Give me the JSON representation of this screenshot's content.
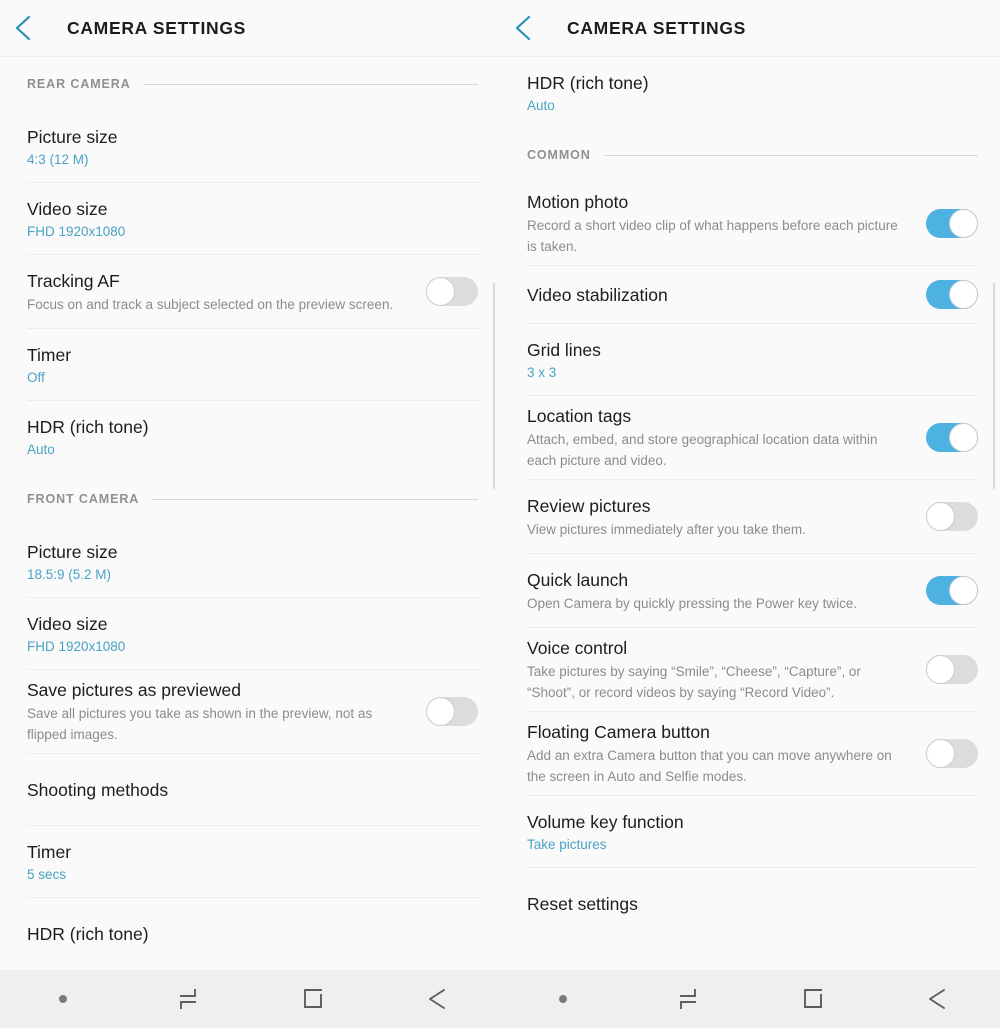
{
  "theme": {
    "accent_blue": "#4aa2c4",
    "toggle_on": "#4db2e2",
    "toggle_off": "#dcdcdc",
    "chevron": "#2290b8",
    "background": "#fafafa",
    "navbar_background": "#efefef"
  },
  "left_panel": {
    "header": {
      "title": "CAMERA SETTINGS",
      "back_icon": "chevron-left-icon"
    },
    "items": [
      {
        "kind": "section",
        "label": "REAR CAMERA"
      },
      {
        "kind": "value",
        "title": "Picture size",
        "value": "4:3 (12 M)"
      },
      {
        "kind": "value",
        "title": "Video size",
        "value": "FHD 1920x1080"
      },
      {
        "kind": "toggle_desc",
        "title": "Tracking AF",
        "desc": "Focus on and track a subject selected on the preview screen.",
        "toggle": "off"
      },
      {
        "kind": "value",
        "title": "Timer",
        "value": "Off"
      },
      {
        "kind": "value",
        "title": "HDR (rich tone)",
        "value": "Auto"
      },
      {
        "kind": "section",
        "label": "FRONT CAMERA"
      },
      {
        "kind": "value",
        "title": "Picture size",
        "value": "18.5:9 (5.2 M)"
      },
      {
        "kind": "value",
        "title": "Video size",
        "value": "FHD 1920x1080"
      },
      {
        "kind": "toggle_desc",
        "title": "Save pictures as previewed",
        "desc": "Save all pictures you take as shown in the preview, not as flipped images.",
        "toggle": "off"
      },
      {
        "kind": "simple",
        "title": "Shooting methods"
      },
      {
        "kind": "value",
        "title": "Timer",
        "value": "5 secs"
      },
      {
        "kind": "simple",
        "title": "HDR (rich tone)"
      }
    ]
  },
  "right_panel": {
    "header": {
      "title": "CAMERA SETTINGS",
      "back_icon": "chevron-left-icon"
    },
    "items": [
      {
        "kind": "value",
        "title": "HDR (rich tone)",
        "value": "Auto"
      },
      {
        "kind": "section",
        "label": "COMMON"
      },
      {
        "kind": "toggle_desc",
        "title": "Motion photo",
        "desc": "Record a short video clip of what happens before each picture is taken.",
        "toggle": "on"
      },
      {
        "kind": "toggle_plain",
        "title": "Video stabilization",
        "toggle": "on"
      },
      {
        "kind": "value",
        "title": "Grid lines",
        "value": "3 x 3"
      },
      {
        "kind": "toggle_desc",
        "title": "Location tags",
        "desc": "Attach, embed, and store geographical location data within each picture and video.",
        "toggle": "on"
      },
      {
        "kind": "toggle_desc",
        "title": "Review pictures",
        "desc": "View pictures immediately after you take them.",
        "toggle": "off"
      },
      {
        "kind": "toggle_desc",
        "title": "Quick launch",
        "desc": "Open Camera by quickly pressing the Power key twice.",
        "toggle": "on"
      },
      {
        "kind": "toggle_desc",
        "title": "Voice control",
        "desc": "Take pictures by saying “Smile”, “Cheese”, “Capture”, or “Shoot”, or record videos by saying “Record Video”.",
        "toggle": "off"
      },
      {
        "kind": "toggle_desc",
        "title": "Floating Camera button",
        "desc": "Add an extra Camera button that you can move anywhere on the screen in Auto and Selfie modes.",
        "toggle": "off"
      },
      {
        "kind": "value",
        "title": "Volume key function",
        "value": "Take pictures"
      },
      {
        "kind": "simple",
        "title": "Reset settings"
      }
    ]
  },
  "navbar": {
    "buttons": [
      {
        "icon": "navbar-show-hide-dot-icon",
        "name": "show-hide-navigation-bar-button"
      },
      {
        "icon": "recents-icon",
        "name": "recents-button"
      },
      {
        "icon": "home-square-icon",
        "name": "home-button"
      },
      {
        "icon": "back-arrow-icon",
        "name": "back-button"
      }
    ]
  }
}
